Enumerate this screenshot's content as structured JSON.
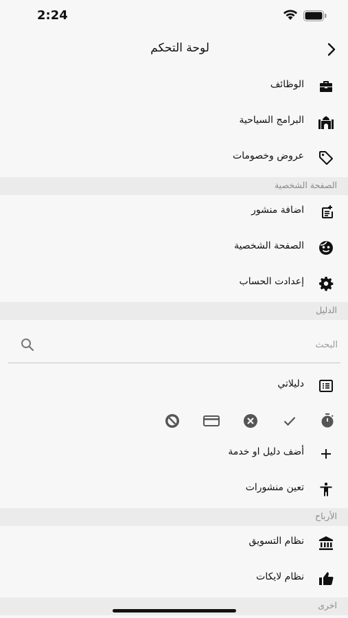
{
  "status": {
    "time": "2:24"
  },
  "header": {
    "title": "لوحة التحكم"
  },
  "dashboard": {
    "items": [
      {
        "label": "الوظائف",
        "icon": "briefcase-icon"
      },
      {
        "label": "البرامج السياحية",
        "icon": "mosque-icon"
      },
      {
        "label": "عروض وخصومات",
        "icon": "tag-icon"
      }
    ]
  },
  "profile_section": {
    "title": "الصفحة الشخصية",
    "items": [
      {
        "label": "اضافة منشور",
        "icon": "post-add-icon"
      },
      {
        "label": "الصفحة الشخصية",
        "icon": "face-icon"
      },
      {
        "label": "إعدادت الحساب",
        "icon": "settings-icon"
      }
    ]
  },
  "directory_section": {
    "title": "الدليل",
    "search_placeholder": "البحث",
    "items": [
      {
        "label": "دليلاتي",
        "icon": "list-alt-icon"
      }
    ],
    "status_icons": [
      "timer-icon",
      "check-icon",
      "cancel-icon",
      "credit-card-icon",
      "block-icon"
    ],
    "more_items": [
      {
        "label": "أضف دليل او خدمة",
        "icon": "add-icon"
      },
      {
        "label": "تعين منشورات",
        "icon": "accessibility-icon"
      }
    ]
  },
  "earnings_section": {
    "title": "الأرباح",
    "items": [
      {
        "label": "نظام التسويق",
        "icon": "bank-icon"
      },
      {
        "label": "نظام لايكات",
        "icon": "thumb-up-icon"
      }
    ]
  },
  "other_section": {
    "title": "اخرى"
  }
}
